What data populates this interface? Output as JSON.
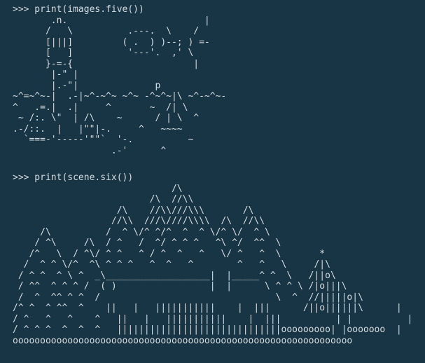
{
  "terminal": {
    "background": "#173544",
    "foreground": "#d8dde0"
  },
  "blocks": [
    {
      "lines": [
        ">>> print(images.five())",
        "       .n.                         |",
        "      /   \\          .---.  \\    /",
        "      [|||]         ( .  ) )--; ) =-",
        "      [   ]          '---'.  ,' \\",
        "      }-=-{                      |",
        "       |-\" |",
        "       |.-\"|              p",
        "~^=~^~-|  .-|~^-~^~ ~^~ -^~^~|\\ ~^-~^~-",
        "^   .=.|  .|     ^       ~  /| \\",
        " ~ /:. \\\"  | /\\    ~      / | \\  ^",
        ".-/::.  |   |\"\"|-.     ^   ~~~~",
        "  `===-'-----'\"\"`  '-.          ~",
        "                  .-'      ^"
      ]
    },
    {
      "lines": [
        ">>> print(scene.six())",
        "                             /\\",
        "                         /\\  //\\\\",
        "                   /\\    //\\\\///\\\\\\       /\\",
        "                  //\\\\  ///\\////\\\\\\\\  /\\  //\\\\",
        "     /\\          /  ^ \\/^ ^/^  ^  ^ \\/^ \\/  ^ \\",
        "    / ^\\     /\\  / ^   /  ^/ ^ ^ ^   ^\\ ^/  ^^  \\",
        "   /^   \\  / ^\\/ ^ ^   ^ / ^  ^   ^   \\/ ^   ^  \\       *",
        "  /  ^ ^ \\/^  ^\\ ^ ^ ^   ^  ^   ^        ^   ^   \\     /|\\",
        " / ^ ^  ^ \\ ^  _\\___________________|  |_____^ ^  \\   /||o\\",
        " / ^^  ^ ^ ^ /  ( )                 |  |      \\ ^ ^ \\ /|o|||\\",
        " /  ^  ^^ ^ ^  /                                \\  ^  //|||||o|\\",
        "/^ ^  ^ ^^  ^    ||   |   |||||||||||    |  |||      /||o||||||\\      |",
        "/ ^   ^   ^    ^   ||   |   |||||||||||    |  |||          | |          |",
        "/ ^ ^ ^  ^  ^  ^   ||||||||||||||||||||||||||||||ooooooooo| |ooooooo  |",
        "oooooooooooooooooooooooooooooooooooooooooooooooooooooooooooooo"
      ]
    }
  ]
}
